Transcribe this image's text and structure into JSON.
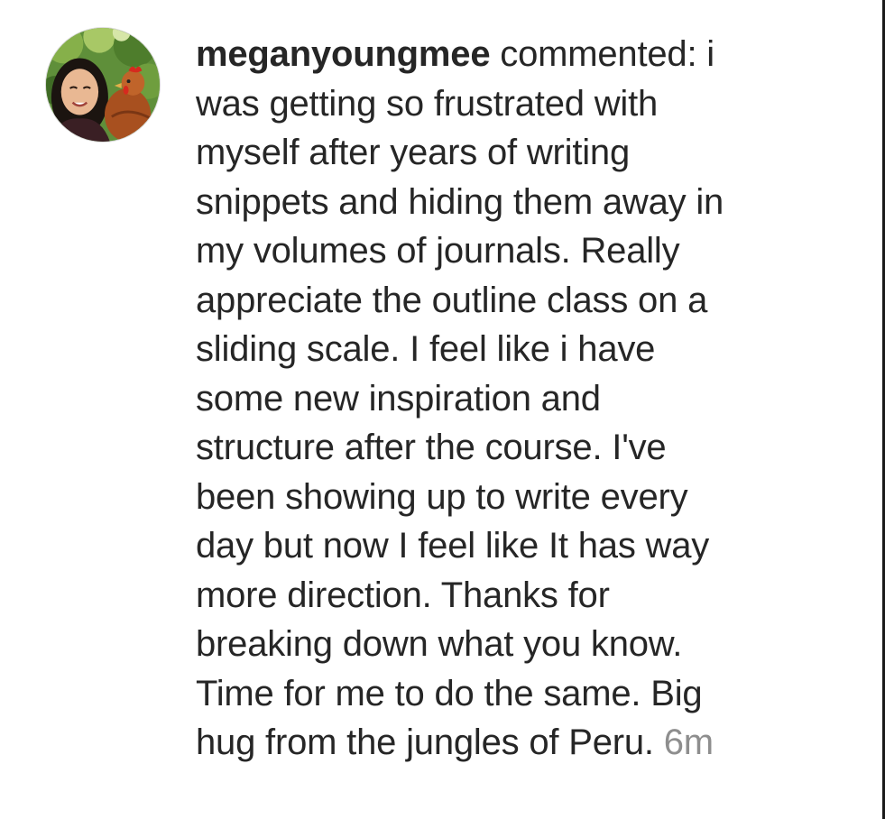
{
  "comment": {
    "username": "meganyoungmee",
    "action": " commented: i",
    "lines": [
      "was getting so frustrated with",
      "myself after years of writing",
      "snippets and hiding them away in",
      "my volumes of journals.  Really",
      "appreciate the outline class on a",
      "sliding scale. I feel like i have",
      "some new inspiration and",
      "structure after the course. I've",
      "been showing up to write every",
      "day but now I feel like It has way",
      "more direction. Thanks for",
      "breaking down what you know.",
      "Time for me to do the same. Big"
    ],
    "last_line": "hug from the jungles of Peru. ",
    "timestamp": "6m"
  },
  "avatar": {
    "icon": "profile-photo-avatar"
  },
  "colors": {
    "text": "#262626",
    "timestamp": "#8e8e8e",
    "background": "#ffffff"
  }
}
